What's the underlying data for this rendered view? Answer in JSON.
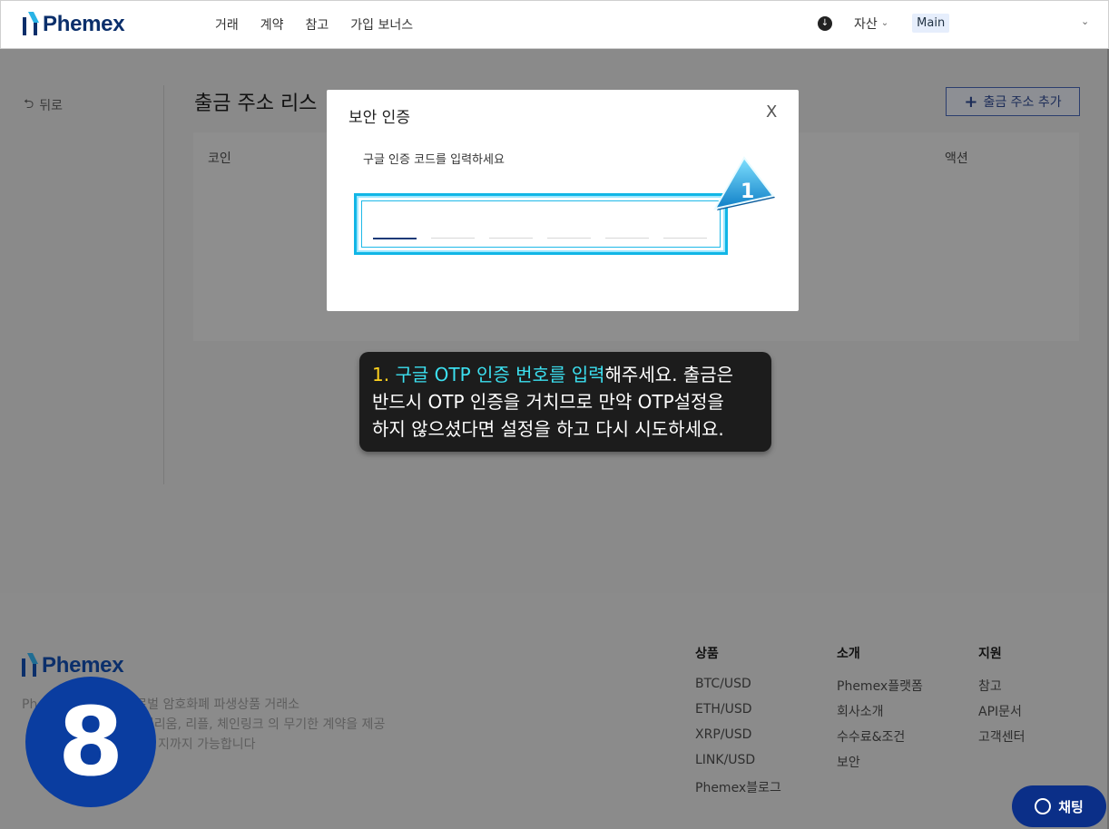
{
  "header": {
    "brand": "Phemex",
    "nav": [
      "거래",
      "계약",
      "참고",
      "가입 보너스"
    ],
    "asset_label": "자산",
    "account_label": "Main"
  },
  "page": {
    "back_label": "뒤로",
    "title": "출금 주소 리스",
    "add_button": "출금 주소 추가",
    "columns": {
      "coin": "코인",
      "action": "액션"
    }
  },
  "modal": {
    "title": "보안 인증",
    "close": "X",
    "subtitle": "구글 인증 코드를 입력하세요",
    "code_length": 6
  },
  "step_badge": "1",
  "tooltip": {
    "num": "1.",
    "highlight": "구글 OTP 인증 번호를 입력",
    "rest1": "해주세요. 출금은",
    "line2": "반드시 OTP 인증을 거치므로 만약 OTP설정을",
    "line3": "하지 않으셨다면 설정을 하고 다시 시도하세요."
  },
  "footer": {
    "brand": "Phemex",
    "desc_line1": "Ph 신뢰할 수 있는 글로벌 암호화폐 파생상품 거래소",
    "desc_line2": "이더리움, 리플, 체인링크 의 무기한 계약을 제공",
    "desc_line3": "지까지 가능합니다",
    "cols": [
      {
        "heading": "상품",
        "items": [
          "BTC/USD",
          "ETH/USD",
          "XRP/USD",
          "LINK/USD",
          "Phemex블로그"
        ]
      },
      {
        "heading": "소개",
        "items": [
          "Phemex플랫폼",
          "회사소개",
          "수수료&조건",
          "보안"
        ]
      },
      {
        "heading": "지원",
        "items": [
          "참고",
          "API문서",
          "고객센터"
        ]
      }
    ]
  },
  "circle_number": "8",
  "chat_label": "채팅",
  "colors": {
    "brand_navy": "#0b2f6b",
    "highlight_cyan": "#3ce0f0",
    "step_yellow": "#ffd21e",
    "circle_blue": "#0a3da0"
  }
}
